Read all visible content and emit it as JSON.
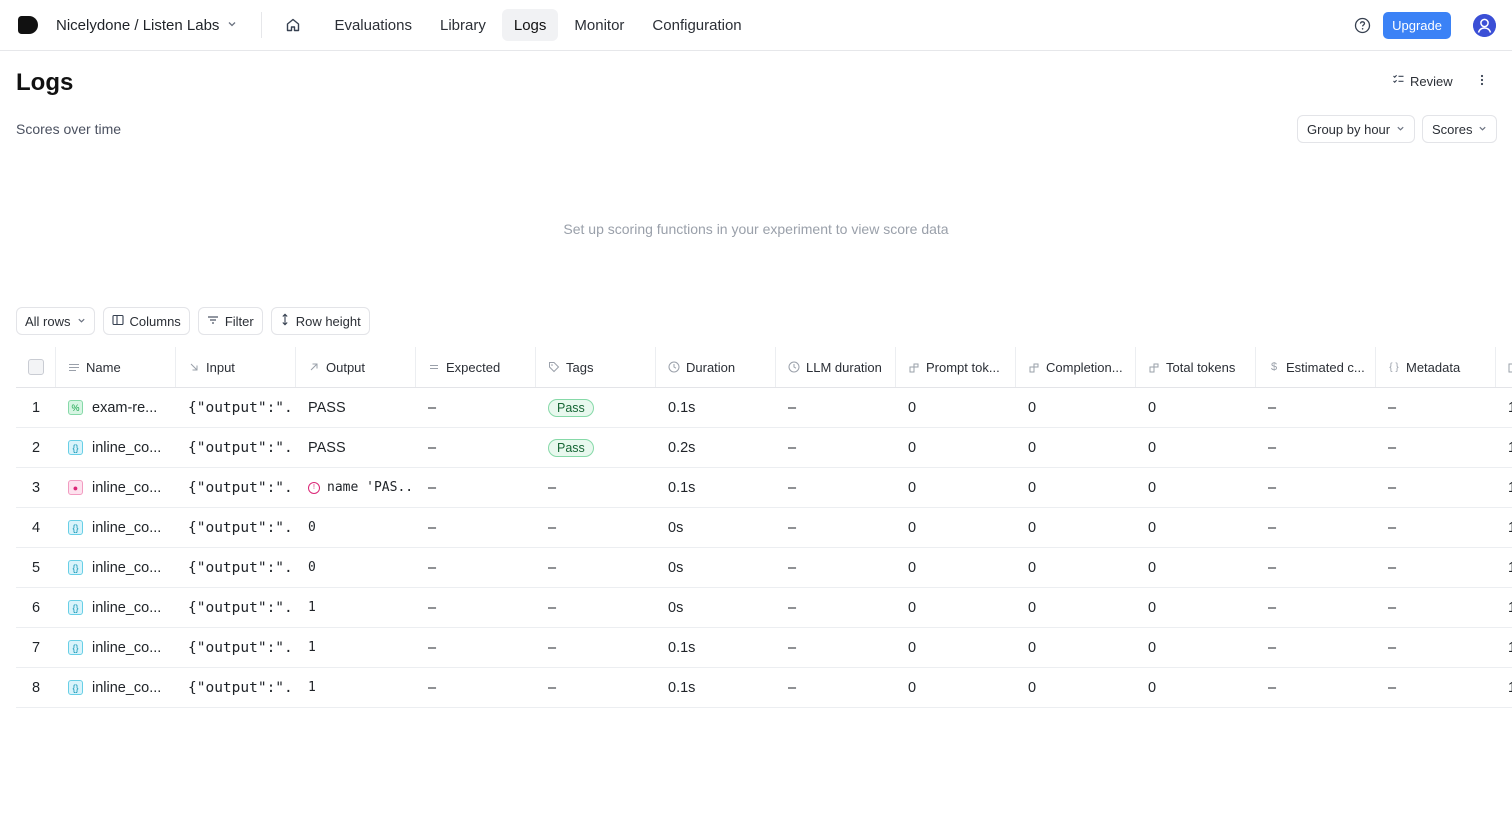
{
  "topbar": {
    "org_label": "Nicelydone / Listen Labs",
    "nav": [
      {
        "label": "Evaluations",
        "active": false
      },
      {
        "label": "Library",
        "active": false
      },
      {
        "label": "Logs",
        "active": true
      },
      {
        "label": "Monitor",
        "active": false
      },
      {
        "label": "Configuration",
        "active": false
      }
    ],
    "upgrade_label": "Upgrade",
    "accent_color": "#3b82f6"
  },
  "page": {
    "title": "Logs",
    "review_label": "Review",
    "subtitle": "Scores over time",
    "group_by_label": "Group by hour",
    "scores_label": "Scores",
    "empty_message": "Set up scoring functions in your experiment to view score data"
  },
  "toolbar": {
    "all_rows_label": "All rows",
    "columns_label": "Columns",
    "filter_label": "Filter",
    "row_height_label": "Row height"
  },
  "table": {
    "headers": {
      "name": "Name",
      "input": "Input",
      "output": "Output",
      "expected": "Expected",
      "tags": "Tags",
      "duration": "Duration",
      "llm_duration": "LLM duration",
      "prompt_tokens": "Prompt tok...",
      "completion_tokens": "Completion...",
      "total_tokens": "Total tokens",
      "estimated_cost": "Estimated c...",
      "metadata": "Metadata"
    },
    "rows": [
      {
        "num": "1",
        "name": "exam-re...",
        "icon": "percent-icon",
        "input": "{\"output\":\"...",
        "output": "PASS",
        "output_mono": false,
        "output_error": false,
        "expected": "–",
        "tag": "Pass",
        "duration": "0.1s",
        "llm_duration": "–",
        "prompt_tokens": "0",
        "completion_tokens": "0",
        "total_tokens": "0",
        "estimated_cost": "–",
        "metadata": "–"
      },
      {
        "num": "2",
        "name": "inline_co...",
        "icon": "braces-icon",
        "input": "{\"output\":\"...",
        "output": "PASS",
        "output_mono": false,
        "output_error": false,
        "expected": "–",
        "tag": "Pass",
        "duration": "0.2s",
        "llm_duration": "–",
        "prompt_tokens": "0",
        "completion_tokens": "0",
        "total_tokens": "0",
        "estimated_cost": "–",
        "metadata": "–"
      },
      {
        "num": "3",
        "name": "inline_co...",
        "icon": "error-icon",
        "input": "{\"output\":\"...",
        "output": "name 'PAS...",
        "output_mono": true,
        "output_error": true,
        "expected": "–",
        "tag": "–",
        "duration": "0.1s",
        "llm_duration": "–",
        "prompt_tokens": "0",
        "completion_tokens": "0",
        "total_tokens": "0",
        "estimated_cost": "–",
        "metadata": "–"
      },
      {
        "num": "4",
        "name": "inline_co...",
        "icon": "braces-icon",
        "input": "{\"output\":\"...",
        "output": "0",
        "output_mono": true,
        "output_error": false,
        "expected": "–",
        "tag": "–",
        "duration": "0s",
        "llm_duration": "–",
        "prompt_tokens": "0",
        "completion_tokens": "0",
        "total_tokens": "0",
        "estimated_cost": "–",
        "metadata": "–"
      },
      {
        "num": "5",
        "name": "inline_co...",
        "icon": "braces-icon",
        "input": "{\"output\":\"...",
        "output": "0",
        "output_mono": true,
        "output_error": false,
        "expected": "–",
        "tag": "–",
        "duration": "0s",
        "llm_duration": "–",
        "prompt_tokens": "0",
        "completion_tokens": "0",
        "total_tokens": "0",
        "estimated_cost": "–",
        "metadata": "–"
      },
      {
        "num": "6",
        "name": "inline_co...",
        "icon": "braces-icon",
        "input": "{\"output\":\"...",
        "output": "1",
        "output_mono": true,
        "output_error": false,
        "expected": "–",
        "tag": "–",
        "duration": "0s",
        "llm_duration": "–",
        "prompt_tokens": "0",
        "completion_tokens": "0",
        "total_tokens": "0",
        "estimated_cost": "–",
        "metadata": "–"
      },
      {
        "num": "7",
        "name": "inline_co...",
        "icon": "braces-icon",
        "input": "{\"output\":\"...",
        "output": "1",
        "output_mono": true,
        "output_error": false,
        "expected": "–",
        "tag": "–",
        "duration": "0.1s",
        "llm_duration": "–",
        "prompt_tokens": "0",
        "completion_tokens": "0",
        "total_tokens": "0",
        "estimated_cost": "–",
        "metadata": "–"
      },
      {
        "num": "8",
        "name": "inline_co...",
        "icon": "braces-icon",
        "input": "{\"output\":\"...",
        "output": "1",
        "output_mono": true,
        "output_error": false,
        "expected": "–",
        "tag": "–",
        "duration": "0.1s",
        "llm_duration": "–",
        "prompt_tokens": "0",
        "completion_tokens": "0",
        "total_tokens": "0",
        "estimated_cost": "–",
        "metadata": "–"
      }
    ]
  }
}
